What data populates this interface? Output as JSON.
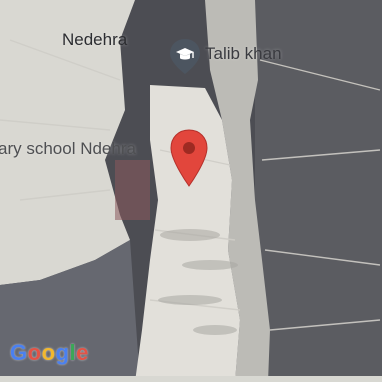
{
  "map": {
    "labels": {
      "village": "Nedehra",
      "school": "ary school Ndehra",
      "person": "Talib khan"
    },
    "icons": {
      "poi": "graduation-cap-pin-icon",
      "marker": "location-pin-icon"
    },
    "colors": {
      "pin": "#e2463c",
      "poi_icon": "#4c5560",
      "road": "#e8e6e0",
      "background": "#4b4c52"
    }
  },
  "brand": {
    "logo_letters": [
      "G",
      "o",
      "o",
      "g",
      "l",
      "e"
    ],
    "logo_colors": [
      "#4a80f0",
      "#e35346",
      "#f2b82e",
      "#4a80f0",
      "#3aa757",
      "#e35346"
    ]
  }
}
